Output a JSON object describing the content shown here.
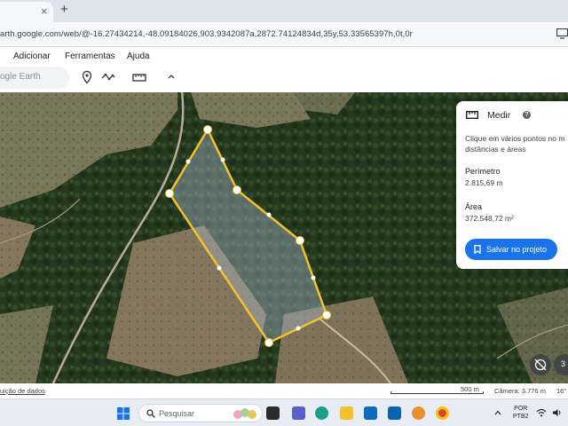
{
  "browser": {
    "tab_close_glyph": "×",
    "new_tab_glyph": "+",
    "url": "arth.google.com/web/@-16.27434214,-48.09184026,903.9342087a,2872.74124834d,35y,53.33565397h,0t,0r"
  },
  "menu": {
    "items": [
      {
        "label": "Adicionar"
      },
      {
        "label": "Ferramentas"
      },
      {
        "label": "Ajuda"
      }
    ]
  },
  "search": {
    "placeholder": "ogle Earth"
  },
  "toolbar_icons": [
    "location-pin-icon",
    "path-icon",
    "ruler-icon",
    "chevron-up-icon"
  ],
  "measure_panel": {
    "title": "Medir",
    "help_glyph": "?",
    "instructions_line1": "Clique em vários pontos no m",
    "instructions_line2": "distâncias e áreas",
    "perimeter_label": "Perímetro",
    "perimeter_value": "2.815,69 m",
    "area_label": "Área",
    "area_value": "372.548,72 m²",
    "save_button": "Salvar no projeto"
  },
  "map_controls": {
    "three_d_label": "3"
  },
  "status": {
    "attribution": "uição de dados",
    "scale": "500 m",
    "camera": "Câmera: 3.776 m",
    "tilt": "16°"
  },
  "taskbar": {
    "search_placeholder": "Pesquisar",
    "language_line1": "POR",
    "language_line2": "PTB2"
  },
  "colors": {
    "measure_outline": "#f2c12e",
    "primary_button": "#1a73e8"
  }
}
